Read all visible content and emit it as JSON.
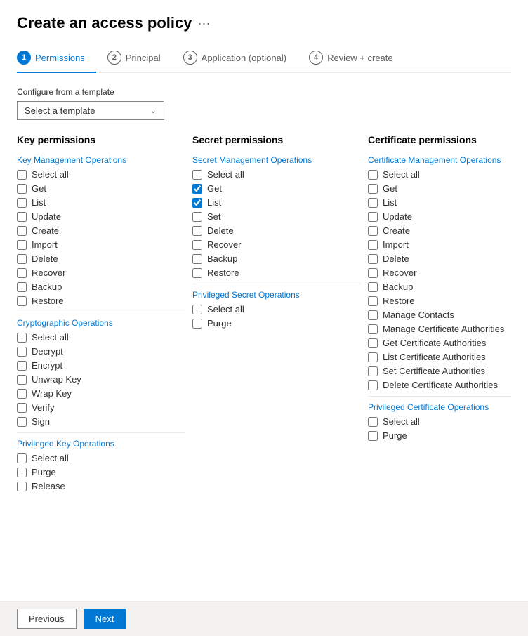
{
  "header": {
    "title": "Create an access policy",
    "more_icon": "···"
  },
  "tabs": [
    {
      "id": "permissions",
      "number": "1",
      "label": "Permissions",
      "active": true
    },
    {
      "id": "principal",
      "number": "2",
      "label": "Principal",
      "active": false
    },
    {
      "id": "application",
      "number": "3",
      "label": "Application (optional)",
      "active": false
    },
    {
      "id": "review",
      "number": "4",
      "label": "Review + create",
      "active": false
    }
  ],
  "template": {
    "configure_label": "Configure from a template",
    "placeholder": "Select a template"
  },
  "columns": {
    "key": {
      "header": "Key permissions",
      "sections": [
        {
          "title": "Key Management Operations",
          "items": [
            {
              "label": "Select all",
              "checked": false
            },
            {
              "label": "Get",
              "checked": false
            },
            {
              "label": "List",
              "checked": false
            },
            {
              "label": "Update",
              "checked": false
            },
            {
              "label": "Create",
              "checked": false
            },
            {
              "label": "Import",
              "checked": false
            },
            {
              "label": "Delete",
              "checked": false
            },
            {
              "label": "Recover",
              "checked": false
            },
            {
              "label": "Backup",
              "checked": false
            },
            {
              "label": "Restore",
              "checked": false
            }
          ]
        },
        {
          "title": "Cryptographic Operations",
          "items": [
            {
              "label": "Select all",
              "checked": false
            },
            {
              "label": "Decrypt",
              "checked": false
            },
            {
              "label": "Encrypt",
              "checked": false
            },
            {
              "label": "Unwrap Key",
              "checked": false
            },
            {
              "label": "Wrap Key",
              "checked": false
            },
            {
              "label": "Verify",
              "checked": false
            },
            {
              "label": "Sign",
              "checked": false
            }
          ]
        },
        {
          "title": "Privileged Key Operations",
          "items": [
            {
              "label": "Select all",
              "checked": false
            },
            {
              "label": "Purge",
              "checked": false
            },
            {
              "label": "Release",
              "checked": false
            }
          ]
        }
      ]
    },
    "secret": {
      "header": "Secret permissions",
      "sections": [
        {
          "title": "Secret Management Operations",
          "items": [
            {
              "label": "Select all",
              "checked": false
            },
            {
              "label": "Get",
              "checked": true
            },
            {
              "label": "List",
              "checked": true
            },
            {
              "label": "Set",
              "checked": false
            },
            {
              "label": "Delete",
              "checked": false
            },
            {
              "label": "Recover",
              "checked": false
            },
            {
              "label": "Backup",
              "checked": false
            },
            {
              "label": "Restore",
              "checked": false
            }
          ]
        },
        {
          "title": "Privileged Secret Operations",
          "items": [
            {
              "label": "Select all",
              "checked": false
            },
            {
              "label": "Purge",
              "checked": false
            }
          ]
        }
      ]
    },
    "certificate": {
      "header": "Certificate permissions",
      "sections": [
        {
          "title": "Certificate Management Operations",
          "items": [
            {
              "label": "Select all",
              "checked": false
            },
            {
              "label": "Get",
              "checked": false
            },
            {
              "label": "List",
              "checked": false
            },
            {
              "label": "Update",
              "checked": false
            },
            {
              "label": "Create",
              "checked": false
            },
            {
              "label": "Import",
              "checked": false
            },
            {
              "label": "Delete",
              "checked": false
            },
            {
              "label": "Recover",
              "checked": false
            },
            {
              "label": "Backup",
              "checked": false
            },
            {
              "label": "Restore",
              "checked": false
            },
            {
              "label": "Manage Contacts",
              "checked": false
            },
            {
              "label": "Manage Certificate Authorities",
              "checked": false
            },
            {
              "label": "Get Certificate Authorities",
              "checked": false
            },
            {
              "label": "List Certificate Authorities",
              "checked": false
            },
            {
              "label": "Set Certificate Authorities",
              "checked": false
            },
            {
              "label": "Delete Certificate Authorities",
              "checked": false
            }
          ]
        },
        {
          "title": "Privileged Certificate Operations",
          "items": [
            {
              "label": "Select all",
              "checked": false
            },
            {
              "label": "Purge",
              "checked": false
            }
          ]
        }
      ]
    }
  },
  "footer": {
    "previous_label": "Previous",
    "next_label": "Next"
  }
}
